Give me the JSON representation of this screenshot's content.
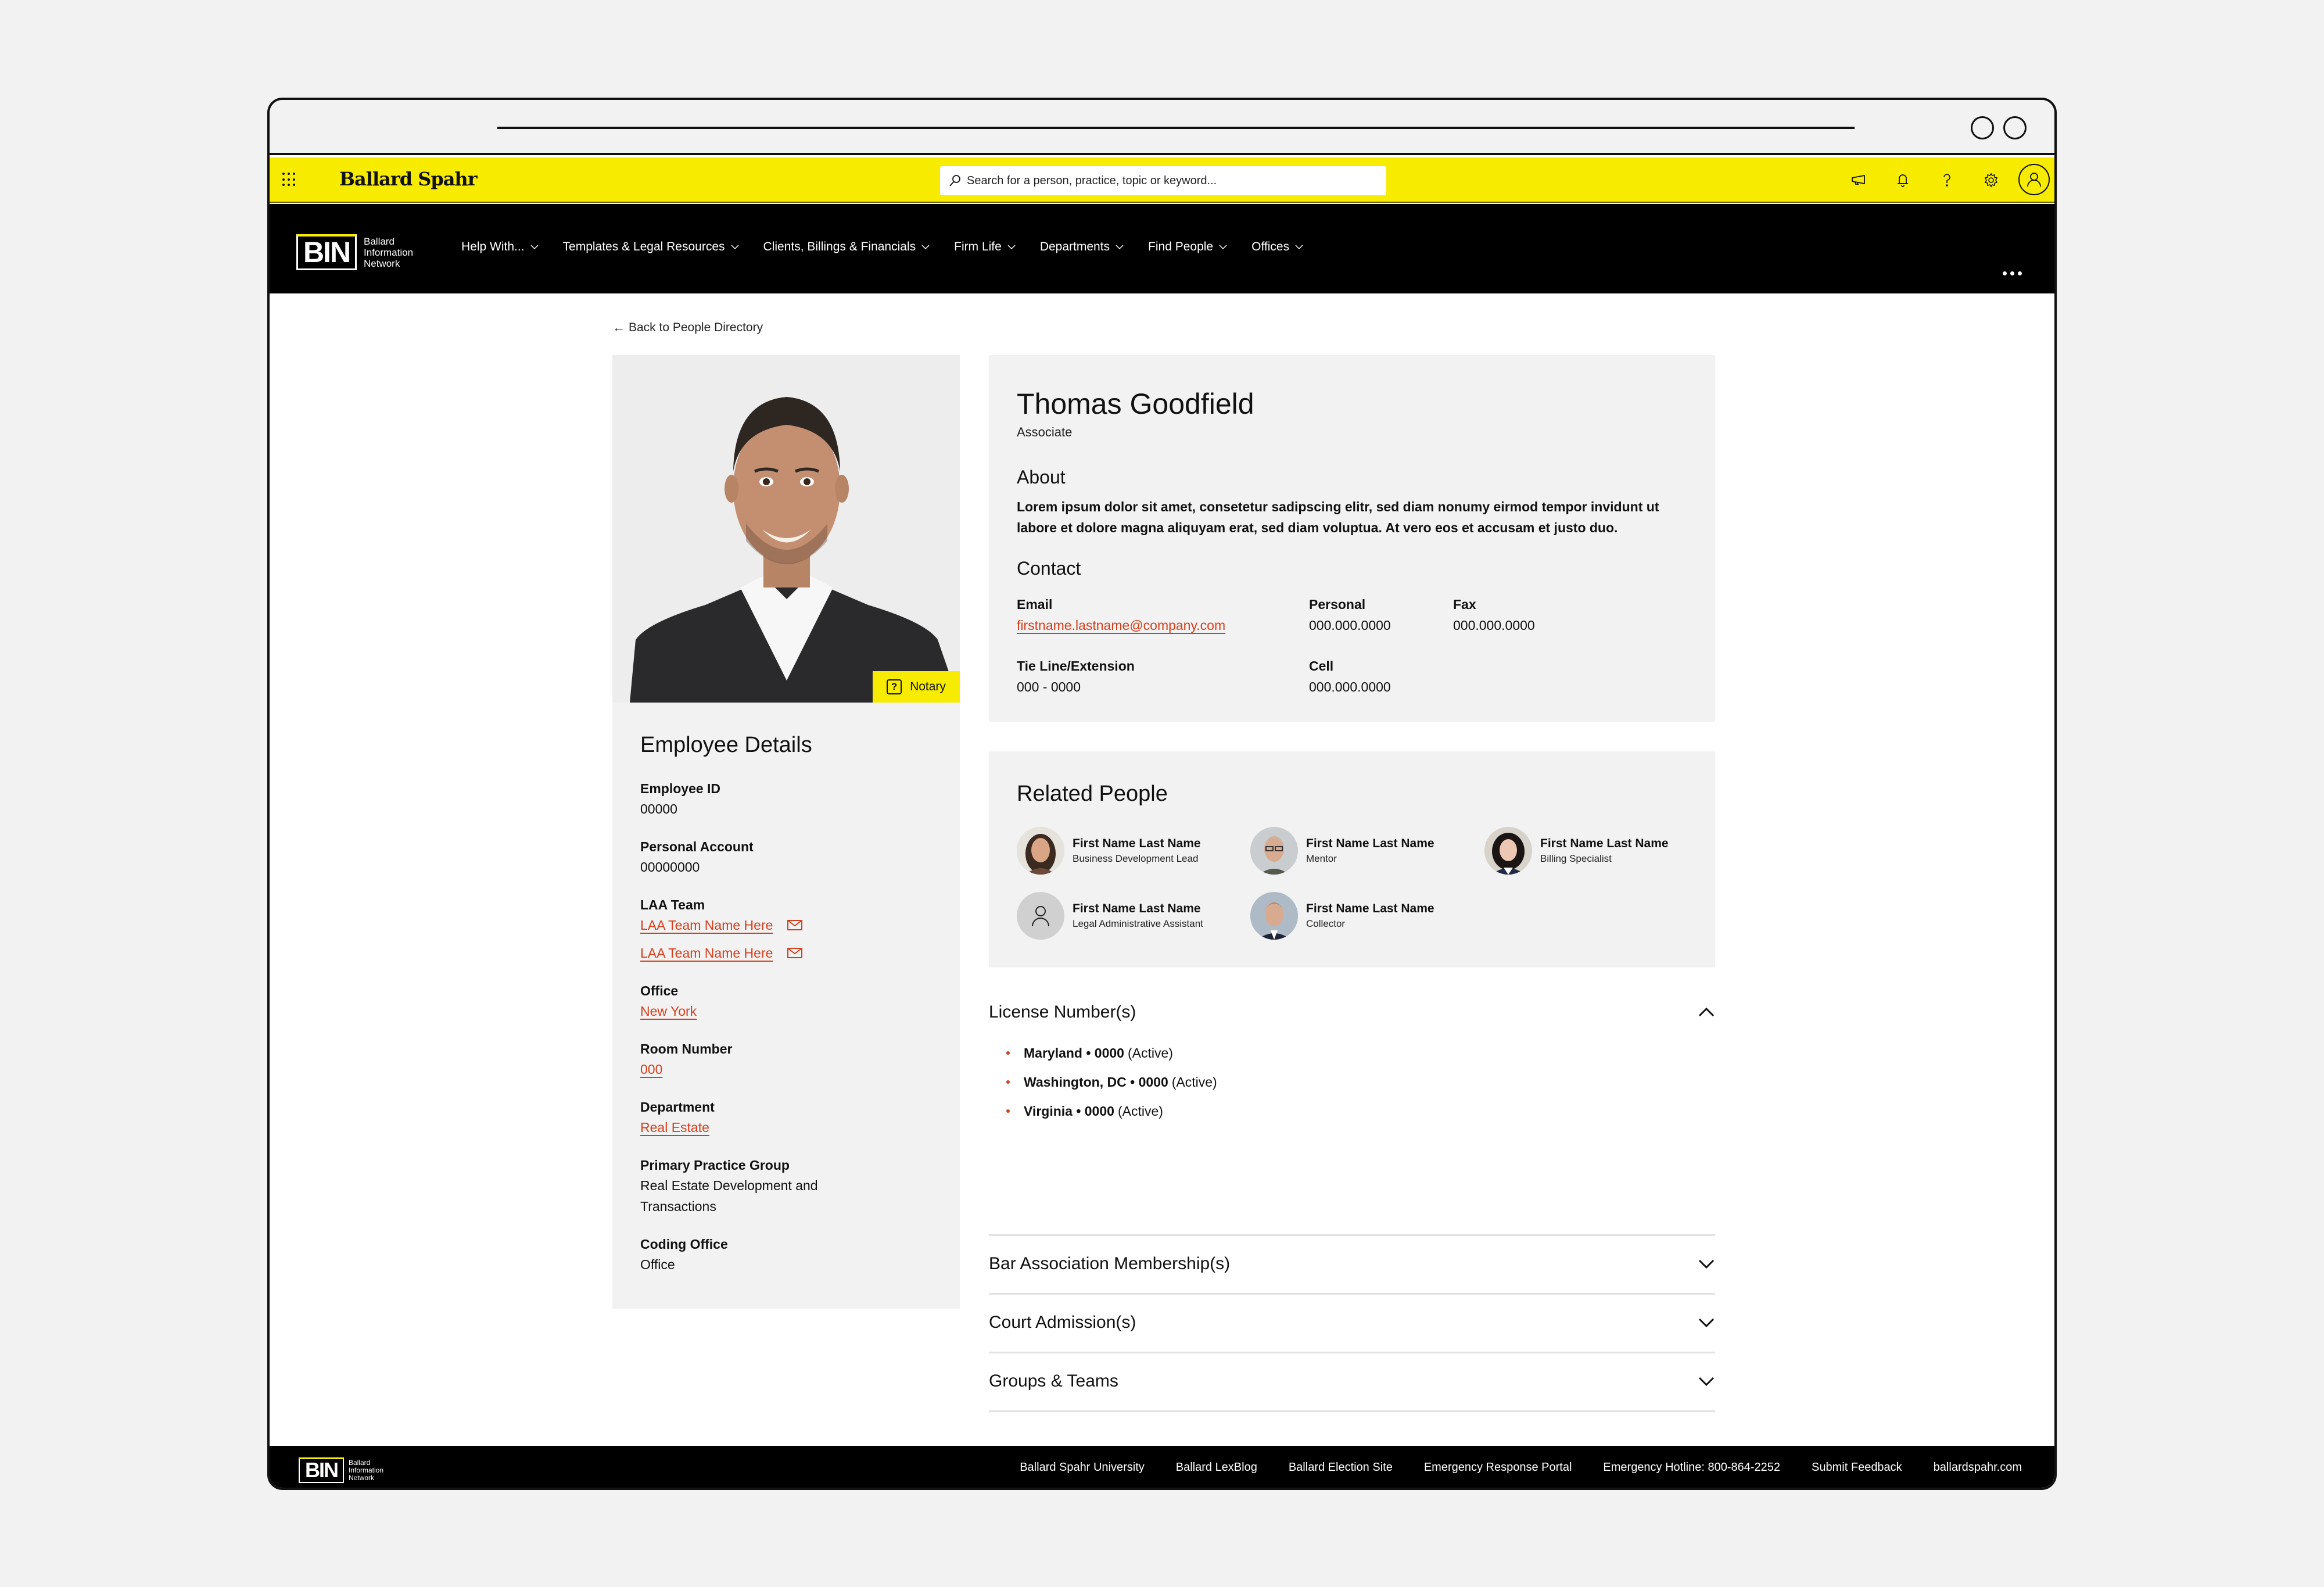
{
  "topbar": {
    "brand": "Ballard Spahr",
    "search_placeholder": "Search for a person, practice, topic or keyword...",
    "icons": [
      "megaphone-icon",
      "bell-icon",
      "help-icon",
      "gear-icon",
      "user-avatar-icon"
    ]
  },
  "nav": {
    "logo_mark": "BIN",
    "logo_text": [
      "Ballard",
      "Information",
      "Network"
    ],
    "items": [
      {
        "label": "Help With..."
      },
      {
        "label": "Templates & Legal Resources"
      },
      {
        "label": "Clients, Billings & Financials"
      },
      {
        "label": "Firm Life"
      },
      {
        "label": "Departments"
      },
      {
        "label": "Find People"
      },
      {
        "label": "Offices"
      }
    ]
  },
  "back_link": "Back to People Directory",
  "profile": {
    "badge": "Notary",
    "name": "Thomas Goodfield",
    "title": "Associate",
    "about_heading": "About",
    "about": "Lorem ipsum dolor sit amet, consetetur sadipscing elitr, sed diam nonumy eirmod tempor invidunt ut labore et dolore magna aliquyam erat, sed diam voluptua. At vero eos et accusam et justo duo.",
    "contact_heading": "Contact",
    "contact": {
      "email_label": "Email",
      "email": "firstname.lastname@company.com",
      "personal_label": "Personal",
      "personal": "000.000.0000",
      "fax_label": "Fax",
      "fax": "000.000.0000",
      "tieline_label": "Tie Line/Extension",
      "tieline": "000 - 0000",
      "cell_label": "Cell",
      "cell": "000.000.0000"
    }
  },
  "employee_details": {
    "heading": "Employee Details",
    "employee_id_label": "Employee ID",
    "employee_id": "00000",
    "personal_account_label": "Personal Account",
    "personal_account": "00000000",
    "laa_team_label": "LAA Team",
    "laa_teams": [
      "LAA Team Name Here",
      "LAA Team Name Here"
    ],
    "office_label": "Office",
    "office": "New York",
    "room_label": "Room Number",
    "room": "000",
    "department_label": "Department",
    "department": "Real Estate",
    "practice_group_label": "Primary Practice Group",
    "practice_group": "Real Estate Development and Transactions",
    "coding_office_label": "Coding Office",
    "coding_office": "Office"
  },
  "related_people": {
    "heading": "Related People",
    "people": [
      {
        "name": "First Name Last Name",
        "role": "Business Development Lead"
      },
      {
        "name": "First Name Last Name",
        "role": "Mentor"
      },
      {
        "name": "First Name Last Name",
        "role": "Billing Specialist"
      },
      {
        "name": "First Name Last Name",
        "role": "Legal Administrative Assistant"
      },
      {
        "name": "First Name Last Name",
        "role": "Collector"
      }
    ]
  },
  "accordions": {
    "license": {
      "title": "License Number(s)",
      "expanded": true,
      "items": [
        {
          "place": "Maryland • 0000",
          "status": "(Active)"
        },
        {
          "place": "Washington, DC • 0000",
          "status": "(Active)"
        },
        {
          "place": "Virginia • 0000",
          "status": "(Active)"
        }
      ]
    },
    "bar": {
      "title": "Bar Association Membership(s)",
      "expanded": false
    },
    "court": {
      "title": "Court Admission(s)",
      "expanded": false
    },
    "groups": {
      "title": "Groups & Teams",
      "expanded": false
    }
  },
  "footer": {
    "links": [
      "Ballard Spahr University",
      "Ballard LexBlog",
      "Ballard Election Site",
      "Emergency Response Portal",
      "Emergency Hotline: 800-864-2252",
      "Submit Feedback",
      "ballardspahr.com"
    ]
  },
  "colors": {
    "brand_yellow": "#F7EB00",
    "link_orange": "#D4401C",
    "nav_black": "#000000",
    "card_gray": "#F2F2F2"
  }
}
